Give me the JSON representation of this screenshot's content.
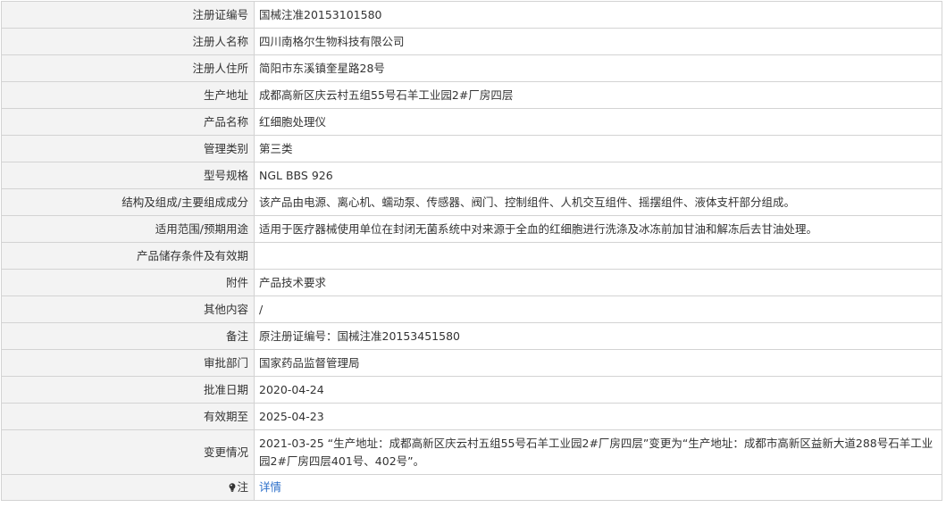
{
  "rows": [
    {
      "label": "注册证编号",
      "value": "国械注准20153101580"
    },
    {
      "label": "注册人名称",
      "value": "四川南格尔生物科技有限公司"
    },
    {
      "label": "注册人住所",
      "value": "简阳市东溪镇奎星路28号"
    },
    {
      "label": "生产地址",
      "value": "成都高新区庆云村五组55号石羊工业园2#厂房四层"
    },
    {
      "label": "产品名称",
      "value": "红细胞处理仪"
    },
    {
      "label": "管理类别",
      "value": "第三类"
    },
    {
      "label": "型号规格",
      "value": "NGL BBS 926"
    },
    {
      "label": "结构及组成/主要组成成分",
      "value": "该产品由电源、离心机、蠕动泵、传感器、阀门、控制组件、人机交互组件、摇摆组件、液体支杆部分组成。"
    },
    {
      "label": "适用范围/预期用途",
      "value": "适用于医疗器械使用单位在封闭无菌系统中对来源于全血的红细胞进行洗涤及冰冻前加甘油和解冻后去甘油处理。"
    },
    {
      "label": "产品储存条件及有效期",
      "value": ""
    },
    {
      "label": "附件",
      "value": "产品技术要求"
    },
    {
      "label": "其他内容",
      "value": "/"
    },
    {
      "label": "备注",
      "value": "原注册证编号：国械注准20153451580"
    },
    {
      "label": "审批部门",
      "value": "国家药品监督管理局"
    },
    {
      "label": "批准日期",
      "value": "2020-04-24"
    },
    {
      "label": "有效期至",
      "value": "2025-04-23"
    },
    {
      "label": "变更情况",
      "value": "2021-03-25 “生产地址：成都高新区庆云村五组55号石羊工业园2#厂房四层”变更为“生产地址：成都市高新区益新大道288号石羊工业园2#厂房四层401号、402号”。"
    }
  ],
  "note": {
    "icon": "lightbulb-icon",
    "label": "注",
    "link_text": "详情",
    "link_color": "#2a6ec9"
  },
  "colors": {
    "label_bg": "#f3f3f3",
    "border": "#d3d3d3",
    "text": "#333333"
  }
}
